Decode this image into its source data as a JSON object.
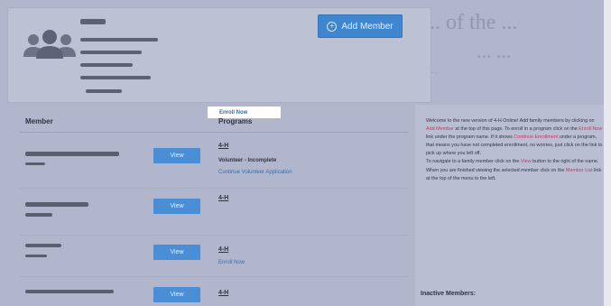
{
  "header": {
    "add_member_label": "Add Member",
    "plus_symbol": "+"
  },
  "ghost_lines": [
    "... of the ...",
    "... ...",
    "... ..."
  ],
  "table": {
    "member_header": "Member",
    "programs_header": "Programs",
    "view_label": "View",
    "rows": [
      {
        "program": "4-H",
        "status": "Volunteer - Incomplete",
        "link": "Continue Volunteer Application"
      },
      {
        "program": "4-H",
        "link": "Enroll Now"
      },
      {
        "program": "4-H",
        "link": "Enroll Now"
      },
      {
        "program": "4-H"
      }
    ]
  },
  "info": {
    "p1_a": "Welcome to the new version of 4-H Online! Add family members by clicking on ",
    "p1_b": "Add Member",
    "p1_c": " at the top of this page. To enroll in a program click on the ",
    "p1_d": "Enroll Now",
    "p1_e": " link under the program name. If it shows ",
    "p1_f": "Continue Enrollment",
    "p1_g": " under a program, that means you have not completed enrollment, no worries, just click on the link to pick up where you left off.",
    "p2_a": "To navigate to a family member click on the ",
    "p2_b": "View",
    "p2_c": " button to the right of the name. When you are finished viewing the selected member click on the ",
    "p2_d": "Member List",
    "p2_e": " link at the top of the menu to the left.",
    "inactive_title": "Inactive Members:"
  },
  "colors": {
    "button_blue": "#3f86d0",
    "link_blue": "#2f6fb7",
    "highlight_pink": "#cc3464",
    "background": "#b1b6cc"
  }
}
